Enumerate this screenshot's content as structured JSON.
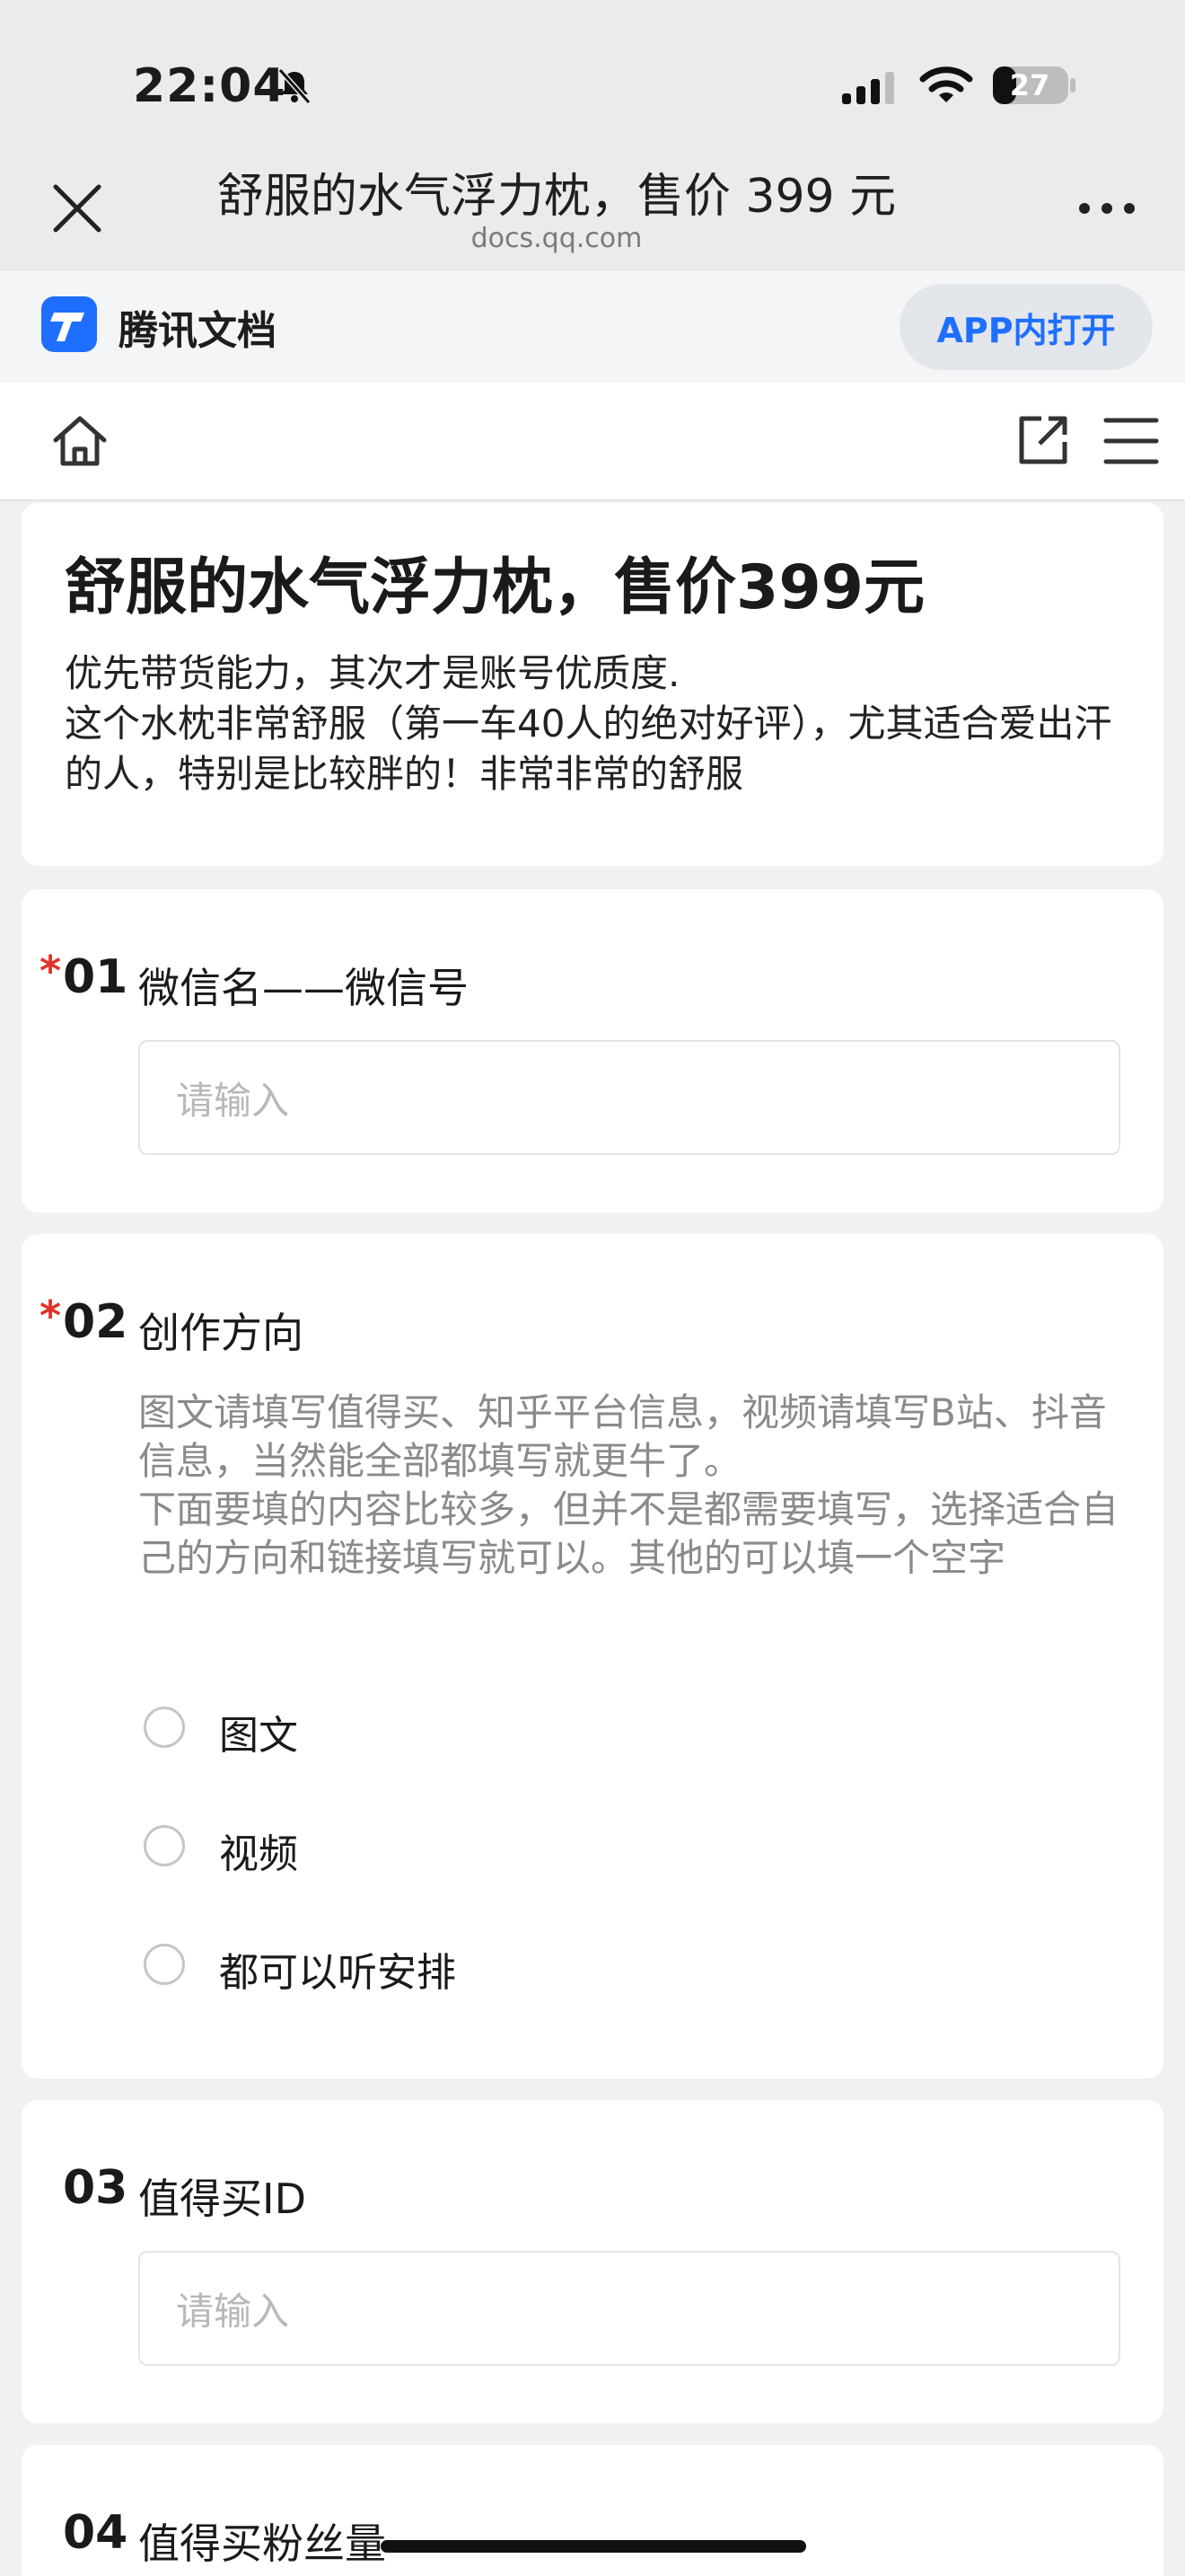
{
  "status_bar": {
    "time": "22:04",
    "battery": "27"
  },
  "nav": {
    "title": "舒服的水气浮力枕，售价 399 元",
    "url": "docs.qq.com"
  },
  "app_bar": {
    "brand": "腾讯文档",
    "open_app_label": "APP内打开"
  },
  "form": {
    "title": "舒服的水气浮力枕，售价399元",
    "description": "优先带货能力，其次才是账号优质度.\n这个水枕非常舒服（第一车40人的绝对好评），尤其适合爱出汗的人，特别是比较胖的！非常非常的舒服"
  },
  "questions": [
    {
      "number": "01",
      "required": "*",
      "label": "微信名——微信号",
      "placeholder": "请输入"
    },
    {
      "number": "02",
      "required": "*",
      "label": "创作方向",
      "hint": "图文请填写值得买、知乎平台信息，视频请填写B站、抖音信息，当然能全部都填写就更牛了。\n下面要填的内容比较多，但并不是都需要填写，选择适合自己的方向和链接填写就可以。其他的可以填一个空字",
      "options": [
        "图文",
        "视频",
        "都可以听安排"
      ]
    },
    {
      "number": "03",
      "label": "值得买ID",
      "placeholder": "请输入"
    },
    {
      "number": "04",
      "label": "值得买粉丝量"
    }
  ]
}
